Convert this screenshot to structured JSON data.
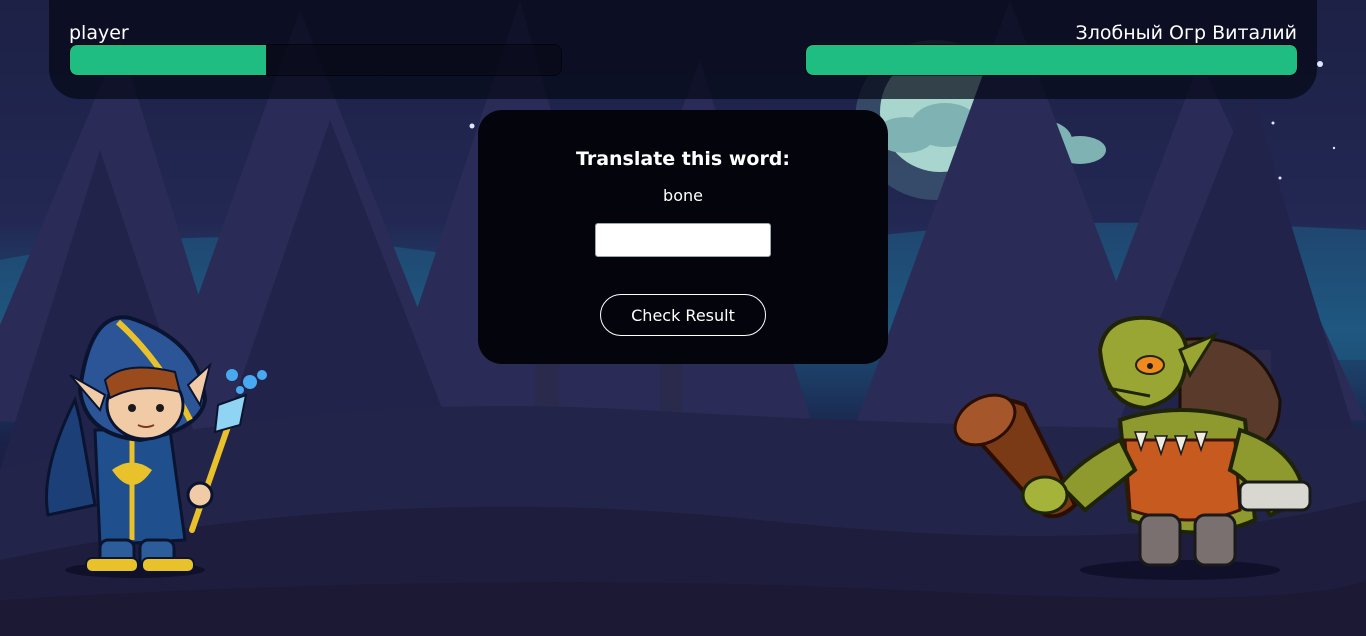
{
  "player": {
    "name": "player",
    "health_fraction": 0.4
  },
  "enemy": {
    "name": "Злобный Огр Виталий",
    "health_fraction": 1.0
  },
  "quiz": {
    "title": "Translate this word:",
    "word": "bone",
    "input_value": "",
    "check_label": "Check Result"
  },
  "colors": {
    "health_bar": "#20bd82",
    "panel": "#03040c",
    "night_sky": "#1d2146",
    "moon": "#a8d6cf"
  }
}
